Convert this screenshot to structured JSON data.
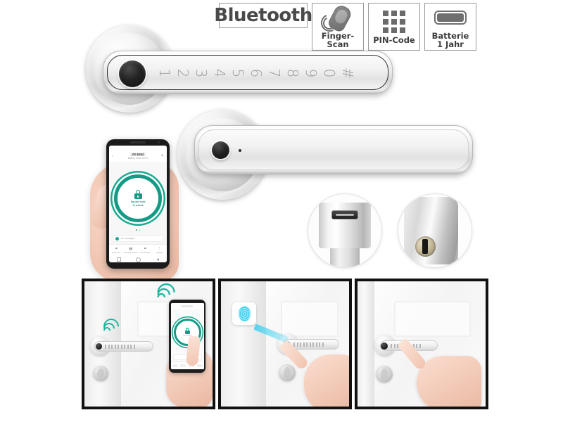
{
  "page": {
    "background_color": "#ffffff",
    "product": "Bluetooth-Türschloss mit Finger-Scan und PIN-Code"
  },
  "badges": [
    {
      "id": "bluetooth",
      "label": "Bluetooth",
      "icon": "bluetooth-wordmark",
      "type": "wordmark"
    },
    {
      "id": "finger-scan",
      "label": "Finger-Scan",
      "icon": "fingerprint-scan-icon",
      "type": "icon"
    },
    {
      "id": "pin-code",
      "label": "PIN-Code",
      "icon": "keypad-grid-icon",
      "type": "icon"
    },
    {
      "id": "batterie",
      "label": "Batterie\n1 Jahr",
      "label_line1": "Batterie",
      "label_line2": "1 Jahr",
      "icon": "battery-icon",
      "type": "icon"
    }
  ],
  "handles": {
    "front": {
      "name": "front-handle-with-keypad",
      "sensor": "fingerprint-sensor",
      "keypad_keys": [
        "1",
        "2",
        "3",
        "4",
        "5",
        "6",
        "7",
        "8",
        "9",
        "0",
        "#"
      ]
    },
    "back": {
      "name": "rear-handle",
      "button": "power-button",
      "pinhole": "reset-pinhole"
    }
  },
  "detail_shots": [
    {
      "id": "usb-port",
      "name": "micro-usb-emergency-charging-port"
    },
    {
      "id": "key-cylinder",
      "name": "mechanical-key-cylinder"
    }
  ],
  "phone": {
    "status_bar": {
      "left": "",
      "right": ""
    },
    "app_bar": {
      "title": "ZX-5262",
      "subtitle": "Battery Level 100 %",
      "back_icon": "chevron-left-icon",
      "edit_icon": "pencil-icon"
    },
    "lock_button": {
      "caption_line1": "Tap and hold",
      "caption_line2": "to unlock",
      "icon": "padlock-icon",
      "color": "#149b86"
    },
    "message_bar": {
      "text": "No messages",
      "icon": "bubble-icon"
    },
    "tabs": [
      {
        "icon": "person-icon",
        "label": "Share eKey"
      },
      {
        "icon": "book-icon",
        "label": "Unlocking Records"
      },
      {
        "icon": "key-icon",
        "label": "Lock Settings"
      },
      {
        "icon": "dots-icon",
        "label": "Settings"
      }
    ],
    "page_dots": {
      "count": 2,
      "active": 0
    },
    "sysnav": [
      "recents-icon",
      "home-icon",
      "back-icon"
    ]
  },
  "scenes": [
    {
      "id": "scene-app-unlock",
      "name": "unlock-via-smartphone-app",
      "signal_icon": "bluetooth-signal-icon",
      "signal_color": "#1fb5a0",
      "elements": [
        "door",
        "handle",
        "knob",
        "smartphone",
        "hand"
      ]
    },
    {
      "id": "scene-fingerprint",
      "name": "unlock-via-fingerprint",
      "badge_icon": "fingerprint-icon",
      "beam_color": "#3fd0ef",
      "elements": [
        "door",
        "handle",
        "knob",
        "fingerprint-card",
        "scan-beam",
        "hand"
      ]
    },
    {
      "id": "scene-pincode",
      "name": "unlock-via-pin-code",
      "elements": [
        "door",
        "handle",
        "knob",
        "hand"
      ]
    }
  ]
}
